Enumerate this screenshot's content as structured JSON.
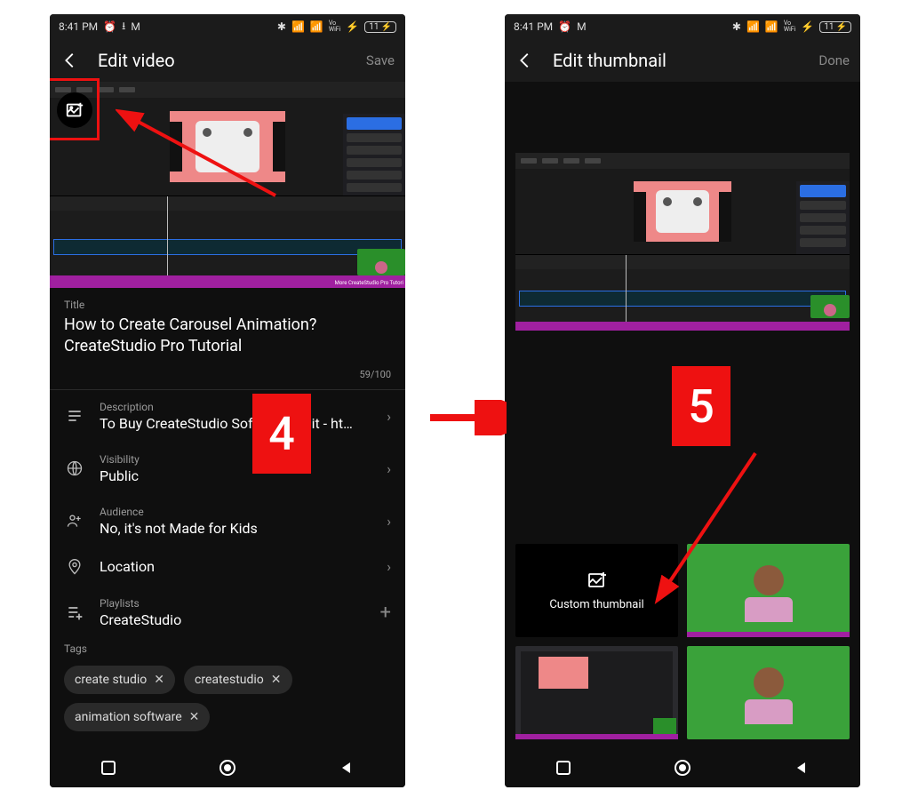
{
  "statusbar": {
    "time": "8:41 PM",
    "battery": "11",
    "vo": "Vo\nWiFi"
  },
  "left": {
    "header": {
      "title": "Edit video",
      "action": "Save"
    },
    "preview": {
      "caption": "More CreateStudio Pro Tutori"
    },
    "form": {
      "title_label": "Title",
      "title_value": "How to Create Carousel Animation? CreateStudio Pro Tutorial",
      "title_counter": "59/100",
      "description_label": "Description",
      "description_value": "To Buy CreateStudio Software Visit - ht…",
      "visibility_label": "Visibility",
      "visibility_value": "Public",
      "audience_label": "Audience",
      "audience_value": "No, it's not Made for Kids",
      "location_label": "Location",
      "playlists_label": "Playlists",
      "playlists_value": "CreateStudio",
      "tags_label": "Tags",
      "tags": [
        "create studio",
        "createstudio",
        "animation software"
      ]
    }
  },
  "right": {
    "header": {
      "title": "Edit thumbnail",
      "action": "Done"
    },
    "custom_thumbnail_label": "Custom thumbnail"
  },
  "annotations": {
    "step_left": "4",
    "step_right": "5"
  }
}
